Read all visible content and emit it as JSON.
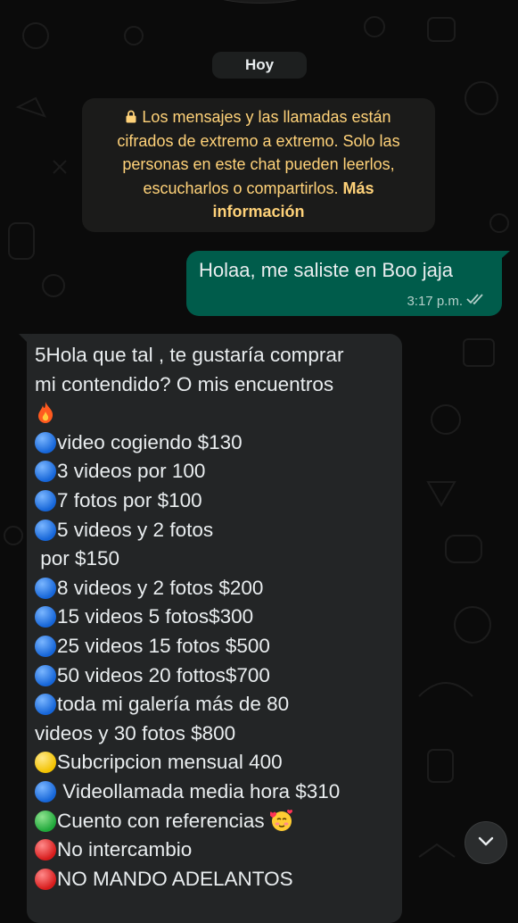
{
  "chat": {
    "date_label": "Hoy",
    "encryption_notice": {
      "line1": "Los mensajes y las llamadas están",
      "line2": "cifrados de extremo a extremo. Solo las",
      "line3": "personas en este chat pueden leerlos,",
      "line4": "escucharlos o compartirlos.",
      "link1": "Más",
      "link2": "información"
    },
    "outgoing": {
      "text": "Holaa, me saliste en Boo jaja",
      "time": "3:17 p.m.",
      "status_icon": "double-check-icon"
    },
    "incoming": {
      "lines": [
        {
          "dot": "",
          "text": "5Hola que tal , te gustaría comprar"
        },
        {
          "dot": "",
          "text": "mi contendido? O mis encuentros"
        },
        {
          "dot": "",
          "text": "",
          "emoji": "fire-emoji"
        },
        {
          "dot": "blue",
          "text": "video cogiendo $130"
        },
        {
          "dot": "blue",
          "text": "3 videos por 100"
        },
        {
          "dot": "blue",
          "text": "7 fotos por $100"
        },
        {
          "dot": "blue",
          "text": "5 videos y 2 fotos"
        },
        {
          "dot": "",
          "text": " por $150"
        },
        {
          "dot": "blue",
          "text": "8 videos y 2 fotos $200"
        },
        {
          "dot": "blue",
          "text": "15 videos 5 fotos$300"
        },
        {
          "dot": "blue",
          "text": "25 videos 15 fotos $500"
        },
        {
          "dot": "blue",
          "text": "50 videos 20 fottos$700"
        },
        {
          "dot": "blue",
          "text": "toda mi galería más de 80"
        },
        {
          "dot": "",
          "text": "videos y 30 fotos $800"
        },
        {
          "dot": "yellow",
          "text": "Subcripcion mensual 400"
        },
        {
          "dot": "blue",
          "text": " Videollamada media hora $310"
        },
        {
          "dot": "green",
          "text": "Cuento con referencias ",
          "emoji": "smiling-hearts-emoji"
        },
        {
          "dot": "red",
          "text": "No intercambio"
        },
        {
          "dot": "red",
          "text": "NO MANDO ADELANTOS"
        }
      ]
    },
    "scroll_button_icon": "chevron-down-icon"
  },
  "colors": {
    "background": "#0b0b0b",
    "outgoing_bubble": "#005c4b",
    "incoming_bubble": "#232526",
    "notice_text": "#ffd279"
  }
}
